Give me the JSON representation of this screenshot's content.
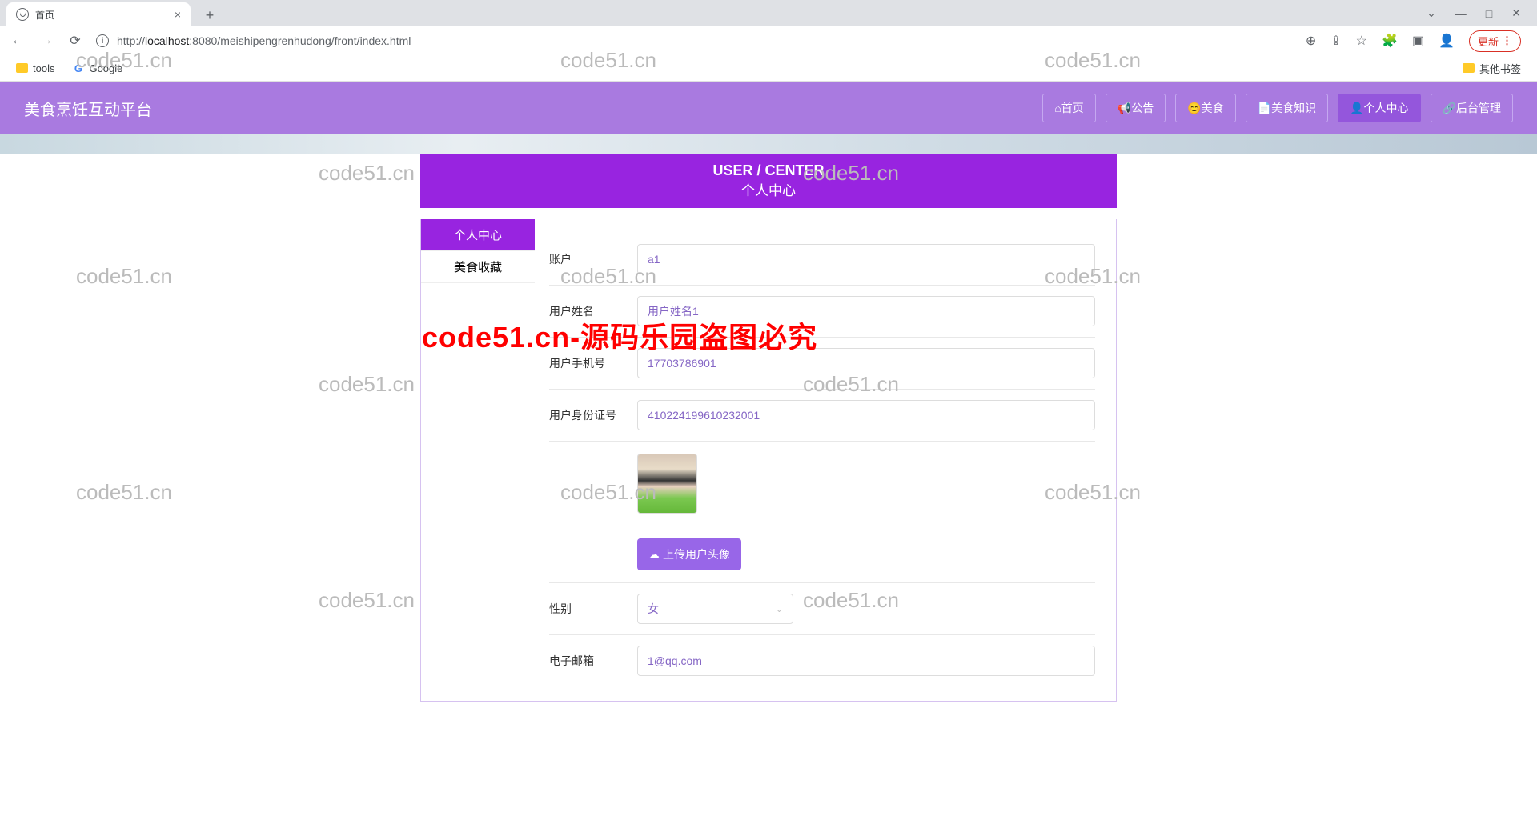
{
  "browser": {
    "tab_title": "首页",
    "url_prefix": "http://",
    "url_host": "localhost",
    "url_path": ":8080/meishipengrenhudong/front/index.html",
    "update": "更新",
    "bookmarks": {
      "tools": "tools",
      "google": "Google",
      "other": "其他书签"
    }
  },
  "header": {
    "title": "美食烹饪互动平台",
    "nav": [
      "⌂首页",
      "📢公告",
      "😊美食",
      "📄美食知识",
      "👤个人中心",
      "🔗后台管理"
    ]
  },
  "panel": {
    "en": "USER / CENTER",
    "zh": "个人中心"
  },
  "tabs": [
    "个人中心",
    "美食收藏"
  ],
  "form": {
    "account_label": "账户",
    "account_value": "a1",
    "name_label": "用户姓名",
    "name_value": "用户姓名1",
    "phone_label": "用户手机号",
    "phone_value": "17703786901",
    "id_label": "用户身份证号",
    "id_value": "410224199610232001",
    "upload_label": "上传用户头像",
    "gender_label": "性别",
    "gender_value": "女",
    "email_label": "电子邮箱",
    "email_value": "1@qq.com"
  },
  "watermark": "code51.cn",
  "watermark_red": "code51.cn-源码乐园盗图必究"
}
